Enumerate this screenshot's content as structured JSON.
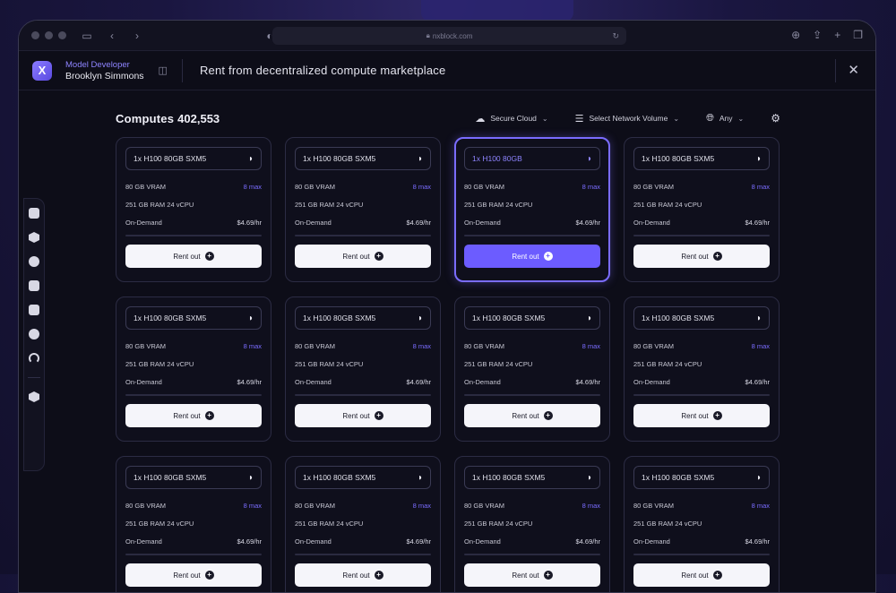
{
  "browser": {
    "url": "nxblock.com",
    "icons": [
      "sidebar-icon",
      "back-icon",
      "forward-icon",
      "shield-icon",
      "lock-icon",
      "reload-icon",
      "download-icon",
      "share-icon",
      "new-tab-icon",
      "tabs-icon"
    ]
  },
  "header": {
    "role": "Model Developer",
    "user_name": "Brooklyn Simmons",
    "logo_letter": "X",
    "title": "Rent from decentralized compute marketplace",
    "close_symbol": "✕"
  },
  "computes": {
    "label": "Computes",
    "count": "402,553"
  },
  "filters": [
    {
      "label": "Secure Cloud",
      "icon": "cloud-icon"
    },
    {
      "label": "Select Network Volume",
      "icon": "list-icon"
    },
    {
      "label": "Any",
      "icon": "globe-icon"
    }
  ],
  "cards": [
    {
      "gpu": "1x H100 80GB SXM5",
      "vram": "80 GB VRAM",
      "max": "8 max",
      "ram": "251 GB RAM  24 vCPU",
      "plan": "On-Demand",
      "price": "$4.69/hr",
      "button": "Rent out",
      "selected": false
    },
    {
      "gpu": "1x H100 80GB SXM5",
      "vram": "80 GB VRAM",
      "max": "8 max",
      "ram": "251 GB RAM  24 vCPU",
      "plan": "On-Demand",
      "price": "$4.69/hr",
      "button": "Rent out",
      "selected": false
    },
    {
      "gpu": "1x H100 80GB",
      "vram": "80 GB VRAM",
      "max": "8 max",
      "ram": "251 GB RAM  24 vCPU",
      "plan": "On-Demand",
      "price": "$4.69/hr",
      "button": "Rent out",
      "selected": true
    },
    {
      "gpu": "1x H100 80GB SXM5",
      "vram": "80 GB VRAM",
      "max": "8 max",
      "ram": "251 GB RAM  24 vCPU",
      "plan": "On-Demand",
      "price": "$4.69/hr",
      "button": "Rent out",
      "selected": false
    },
    {
      "gpu": "1x H100 80GB SXM5",
      "vram": "80 GB VRAM",
      "max": "8 max",
      "ram": "251 GB RAM  24 vCPU",
      "plan": "On-Demand",
      "price": "$4.69/hr",
      "button": "Rent out",
      "selected": false
    },
    {
      "gpu": "1x H100 80GB SXM5",
      "vram": "80 GB VRAM",
      "max": "8 max",
      "ram": "251 GB RAM  24 vCPU",
      "plan": "On-Demand",
      "price": "$4.69/hr",
      "button": "Rent out",
      "selected": false
    },
    {
      "gpu": "1x H100 80GB SXM5",
      "vram": "80 GB VRAM",
      "max": "8 max",
      "ram": "251 GB RAM  24 vCPU",
      "plan": "On-Demand",
      "price": "$4.69/hr",
      "button": "Rent out",
      "selected": false
    },
    {
      "gpu": "1x H100 80GB SXM5",
      "vram": "80 GB VRAM",
      "max": "8 max",
      "ram": "251 GB RAM  24 vCPU",
      "plan": "On-Demand",
      "price": "$4.69/hr",
      "button": "Rent out",
      "selected": false
    },
    {
      "gpu": "1x H100 80GB SXM5",
      "vram": "80 GB VRAM",
      "max": "8 max",
      "ram": "251 GB RAM  24 vCPU",
      "plan": "On-Demand",
      "price": "$4.69/hr",
      "button": "Rent out",
      "selected": false
    },
    {
      "gpu": "1x H100 80GB SXM5",
      "vram": "80 GB VRAM",
      "max": "8 max",
      "ram": "251 GB RAM  24 vCPU",
      "plan": "On-Demand",
      "price": "$4.69/hr",
      "button": "Rent out",
      "selected": false
    },
    {
      "gpu": "1x H100 80GB SXM5",
      "vram": "80 GB VRAM",
      "max": "8 max",
      "ram": "251 GB RAM  24 vCPU",
      "plan": "On-Demand",
      "price": "$4.69/hr",
      "button": "Rent out",
      "selected": false
    },
    {
      "gpu": "1x H100 80GB SXM5",
      "vram": "80 GB VRAM",
      "max": "8 max",
      "ram": "251 GB RAM  24 vCPU",
      "plan": "On-Demand",
      "price": "$4.69/hr",
      "button": "Rent out",
      "selected": false
    }
  ],
  "colors": {
    "accent": "#6c5cff",
    "accent_text": "#8e84ff",
    "background": "#0d0d18",
    "card_border": "#2c2c44"
  }
}
